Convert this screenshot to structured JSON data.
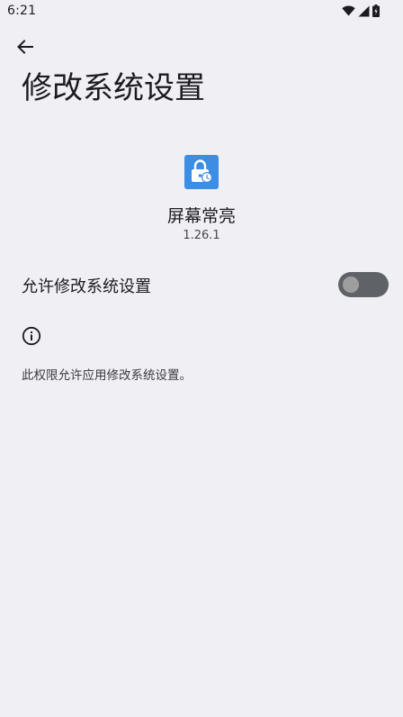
{
  "status_bar": {
    "time": "6:21",
    "icons": [
      "wifi-icon",
      "cell-signal-icon",
      "battery-icon"
    ]
  },
  "header": {
    "back_icon": "back-arrow-icon",
    "title": "修改系统设置"
  },
  "app": {
    "icon": "lock-clock-icon",
    "name": "屏幕常亮",
    "version": "1.26.1",
    "icon_color": "#3b8ee3"
  },
  "permission": {
    "label": "允许修改系统设置",
    "enabled": false
  },
  "info": {
    "icon": "info-icon",
    "text": "此权限允许应用修改系统设置。"
  },
  "colors": {
    "background": "#f0eff4",
    "toggle_track_off": "#5f6368",
    "toggle_thumb_off": "#9e9e9e"
  }
}
